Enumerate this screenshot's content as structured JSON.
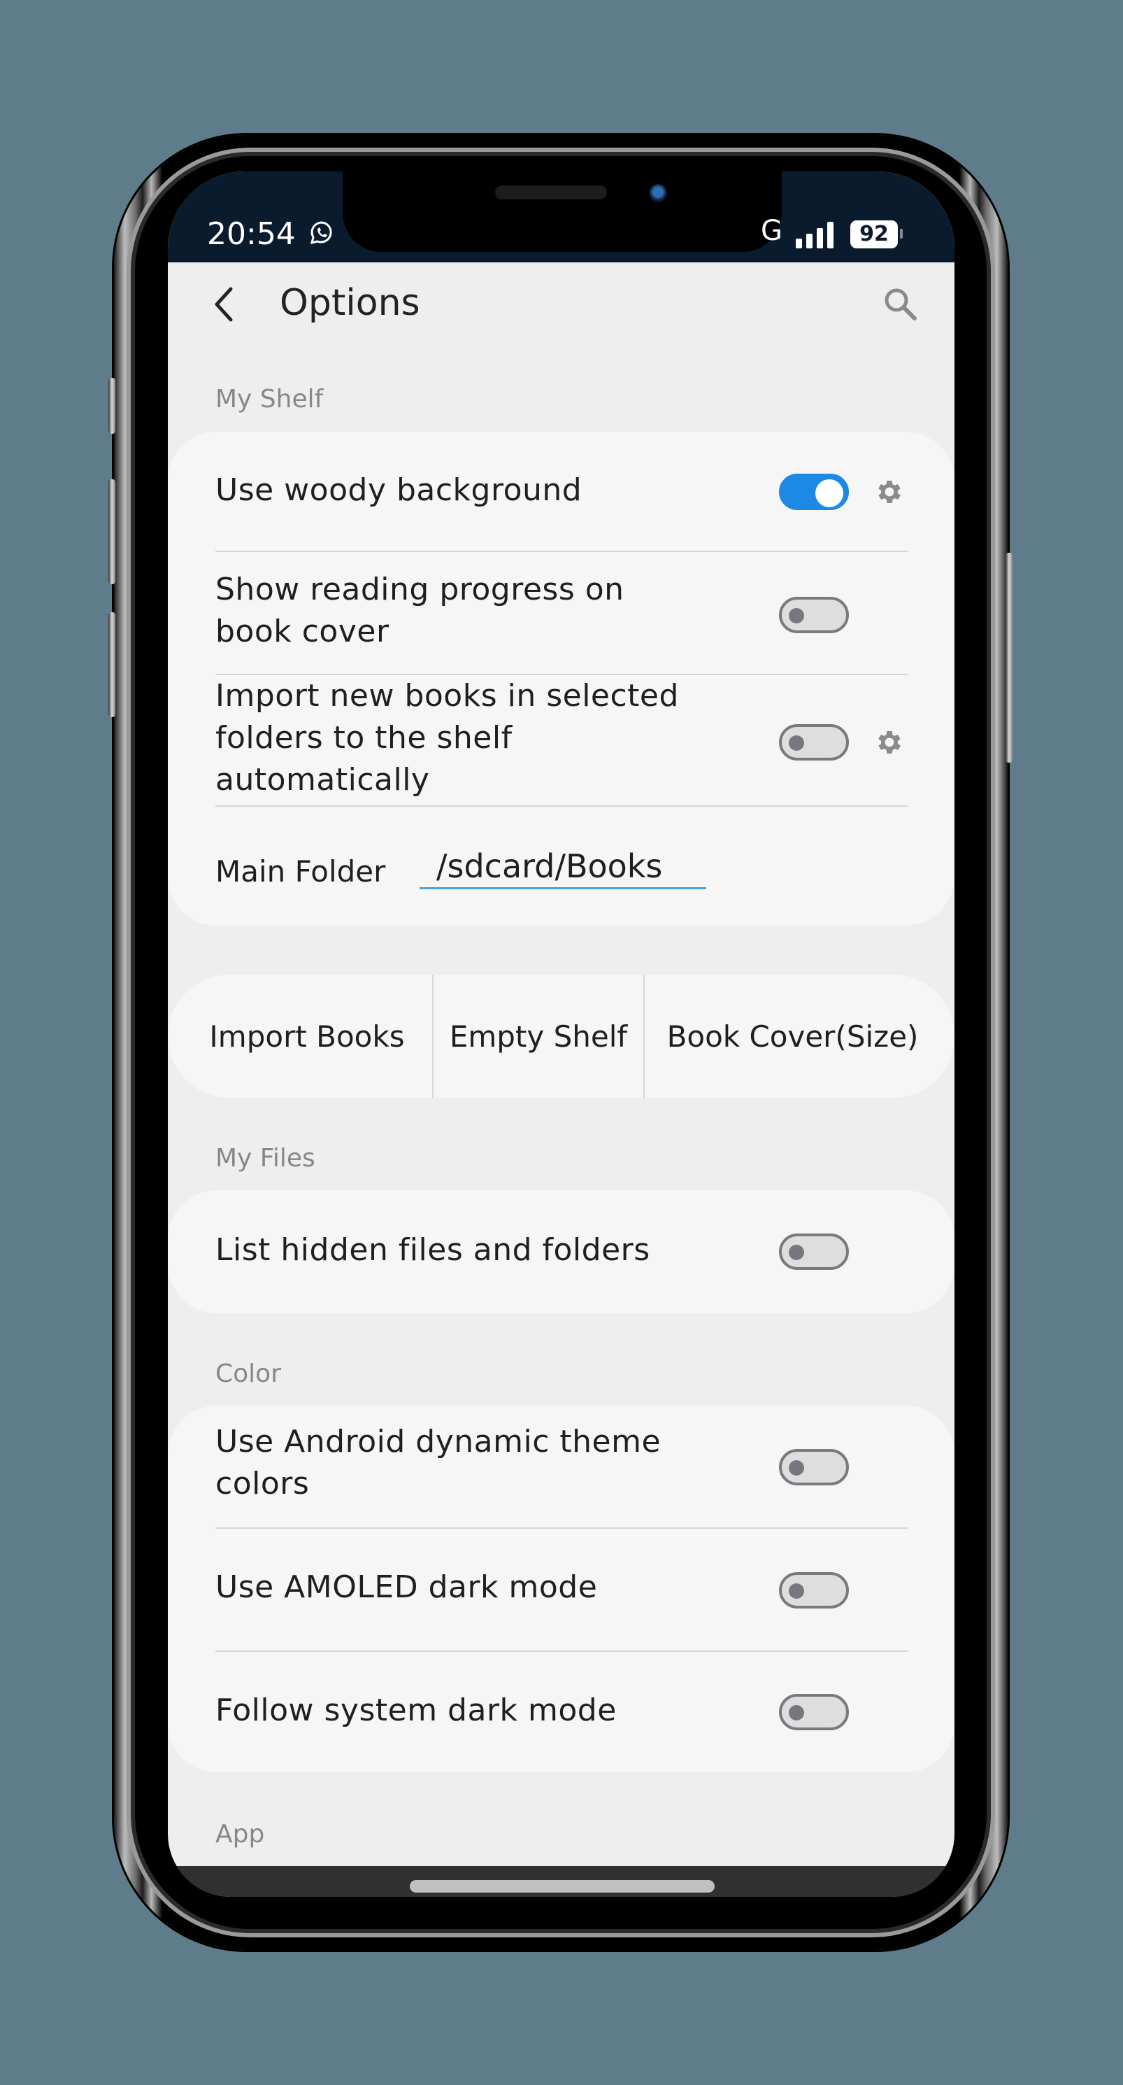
{
  "status_bar": {
    "time": "20:54",
    "notification_icon": "whatsapp-icon",
    "network": "G",
    "signal_icon": "signal-bars-icon",
    "battery": "92"
  },
  "app_bar": {
    "back_icon": "chevron-left-icon",
    "title": "Options",
    "search_icon": "search-icon"
  },
  "colors": {
    "accent": "#1e88e5",
    "status_bar_bg": "#0b1b2e",
    "page_bg": "#eeeeee",
    "card_bg": "#f6f6f6",
    "input_underline": "#4aa3df"
  },
  "sections": {
    "my_shelf": {
      "label": "My Shelf",
      "items": [
        {
          "text": "Use woody background",
          "enabled": true,
          "has_settings": true
        },
        {
          "line1": "Show reading progress on",
          "line2": "book cover",
          "enabled": false,
          "has_settings": false
        },
        {
          "line1": "Import new books in selected",
          "line2": "folders to the shelf",
          "line3": "automatically",
          "enabled": false,
          "has_settings": true
        }
      ],
      "main_folder": {
        "label": "Main Folder",
        "value": "/sdcard/Books"
      }
    },
    "shelf_actions": {
      "buttons": [
        "Import Books",
        "Empty Shelf",
        "Book Cover(Size)"
      ]
    },
    "my_files": {
      "label": "My Files",
      "items": [
        {
          "text": "List hidden files and folders",
          "enabled": false
        }
      ]
    },
    "color": {
      "label": "Color",
      "items": [
        {
          "line1": "Use Android dynamic theme",
          "line2": "colors",
          "enabled": false
        },
        {
          "text": "Use AMOLED dark mode",
          "enabled": false
        },
        {
          "text": "Follow system dark mode",
          "enabled": false
        }
      ]
    },
    "app": {
      "label": "App"
    }
  }
}
